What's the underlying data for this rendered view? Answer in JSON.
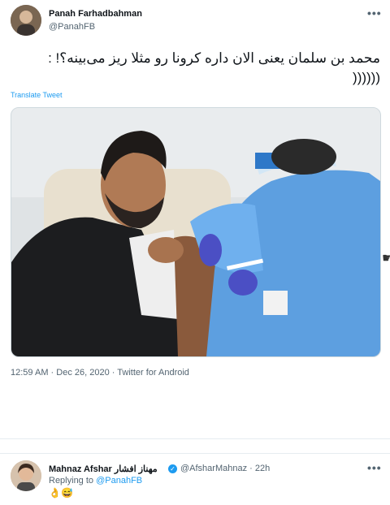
{
  "tweet": {
    "author_name": "Panah Farhadbahman",
    "author_handle": "@PanahFB",
    "text_line1": "محمد بن سلمان یعنی الان داره کرونا رو مثلا ریز می‌بینه؟! :",
    "text_line2": "((((((",
    "translate_label": "Translate Tweet",
    "timestamp": "12:59 AM · Dec 26, 2020 · Twitter for Android",
    "more_label": "•••"
  },
  "reply": {
    "author_name": "Mahnaz Afshar مهناز افشار",
    "author_handle": "@AfsharMahnaz",
    "time": "· 22h",
    "replying_prefix": "Replying to",
    "replying_handle": "@PanahFB",
    "emojis": "👌😅",
    "more_label": "•••"
  },
  "icons": [
    "user-avatar-icon",
    "more-options-icon",
    "verified-badge-icon",
    "cursor-icon"
  ],
  "colors": {
    "link": "#1d9bf0",
    "muted": "#536471",
    "text": "#0f1419"
  }
}
